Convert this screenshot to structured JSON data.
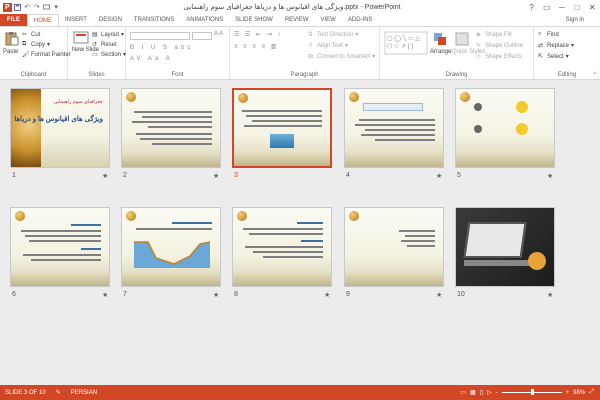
{
  "app": {
    "title": "ویژگی های اقیانوس ها و دریاها جغرافیای سوم راهنمایی.pptx - PowerPoint",
    "logo_letter": "P",
    "window_controls": [
      "?",
      "▭",
      "─",
      "□",
      "✕"
    ]
  },
  "tabs": [
    {
      "label": "FILE"
    },
    {
      "label": "HOME"
    },
    {
      "label": "INSERT"
    },
    {
      "label": "DESIGN"
    },
    {
      "label": "TRANSITIONS"
    },
    {
      "label": "ANIMATIONS"
    },
    {
      "label": "SLIDE SHOW"
    },
    {
      "label": "REVIEW"
    },
    {
      "label": "VIEW"
    },
    {
      "label": "ADD-INS"
    }
  ],
  "signin": "Sign in",
  "ribbon": {
    "clipboard": {
      "label": "Clipboard",
      "paste": "Paste",
      "cut": "Cut",
      "copy": "Copy",
      "format_painter": "Format Painter"
    },
    "slides": {
      "label": "Slides",
      "new_slide": "New Slide",
      "layout": "Layout",
      "reset": "Reset",
      "section": "Section"
    },
    "font": {
      "label": "Font"
    },
    "paragraph": {
      "label": "Paragraph",
      "text_direction": "Text Direction",
      "align_text": "Align Text",
      "convert_smartart": "Convert to SmartArt"
    },
    "drawing": {
      "label": "Drawing",
      "arrange": "Arrange",
      "quick_styles": "Quick Styles",
      "shape_fill": "Shape Fill",
      "shape_outline": "Shape Outline",
      "shape_effects": "Shape Effects"
    },
    "editing": {
      "label": "Editing",
      "find": "Find",
      "replace": "Replace",
      "select": "Select"
    }
  },
  "slides": [
    {
      "num": "1",
      "title_text": "ویژگی های اقیانوس ها و دریاها",
      "header_text": "جغرافیای سوم راهنمایی"
    },
    {
      "num": "2"
    },
    {
      "num": "3",
      "selected": true
    },
    {
      "num": "4"
    },
    {
      "num": "5"
    },
    {
      "num": "6"
    },
    {
      "num": "7"
    },
    {
      "num": "8"
    },
    {
      "num": "9"
    },
    {
      "num": "10"
    }
  ],
  "statusbar": {
    "slide_info": "SLIDE 3 OF 10",
    "language": "PERSIAN",
    "zoom_minus": "-",
    "zoom_plus": "+",
    "zoom": "98%",
    "zoom_level": 0.49
  },
  "colors": {
    "accent": "#d24726"
  }
}
